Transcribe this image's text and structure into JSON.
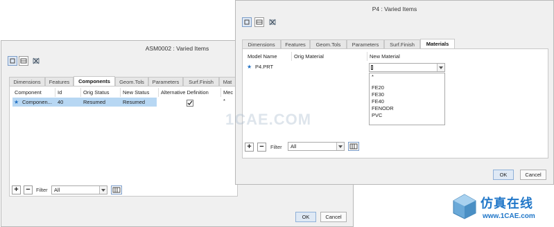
{
  "asm_dialog": {
    "title": "ASM0002 : Varied Items",
    "tabs": [
      "Dimensions",
      "Features",
      "Components",
      "Geom.Tols",
      "Parameters",
      "Surf.Finish",
      "Mat"
    ],
    "columns": [
      "Component",
      "Id",
      "Orig Status",
      "New Status",
      "Alternative Definition",
      "Mec"
    ],
    "row": {
      "component": "Componen...",
      "id": "40",
      "orig_status": "Resumed",
      "new_status": "Resumed",
      "alt_def_checked": true,
      "mec": "*"
    },
    "filter_label": "Filter",
    "filter_value": "All",
    "ok": "OK",
    "cancel": "Cancel"
  },
  "p4_dialog": {
    "title": "P4 : Varied Items",
    "tabs": [
      "Dimensions",
      "Features",
      "Geom.Tols",
      "Parameters",
      "Surf.Finish",
      "Materials"
    ],
    "columns": [
      "Model Name",
      "Orig Material",
      "New Material"
    ],
    "row": {
      "model": "P4.PRT",
      "orig": "",
      "new": ""
    },
    "dropdown_options": [
      "*",
      "",
      "FE20",
      "FE30",
      "FE40",
      "FENODR",
      "PVC"
    ],
    "filter_label": "Filter",
    "filter_value": "All",
    "ok": "OK",
    "cancel": "Cancel"
  },
  "watermark": {
    "center": "1CAE.COM",
    "logo_cn": "仿真在线",
    "logo_url": "www.1CAE.com"
  },
  "colors": {
    "selected_row": "#b7d7f3",
    "ok_button": "#dfe9f5",
    "star": "#1f6fc2"
  }
}
